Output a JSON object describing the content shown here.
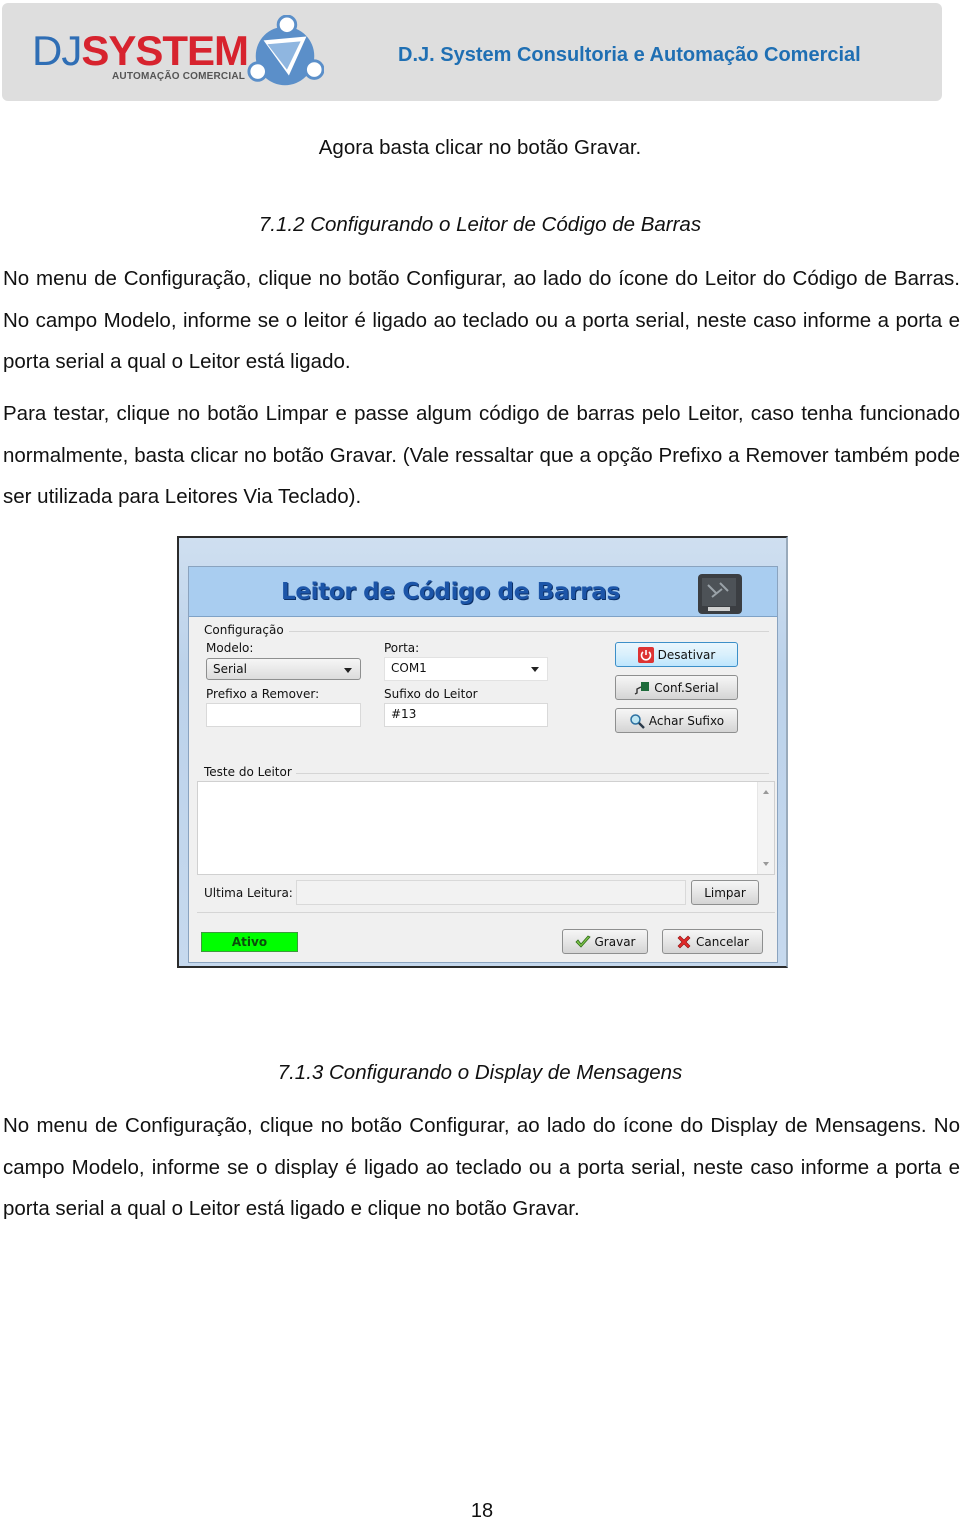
{
  "header": {
    "logo_prefix": "DJ",
    "logo_main": "SYSTEM",
    "logo_subtitle": "AUTOMAÇÃO COMERCIAL",
    "company_name": "D.J. System Consultoria e Automação Comercial",
    "colors": {
      "logo_blue": "#2f6eb5",
      "logo_red": "#d7232e",
      "title_blue": "#1f6fb3",
      "banner_bg": "#dedede"
    }
  },
  "document": {
    "intro_line": "Agora basta clicar no botão Gravar.",
    "section_712": {
      "heading": "7.1.2  Configurando o Leitor de Código de Barras",
      "paragraph_1": "No menu de Configuração, clique no botão Configurar, ao lado do ícone do Leitor do Código de Barras. No campo Modelo, informe se o leitor é ligado ao teclado ou a porta serial, neste caso informe a porta e porta serial a qual o Leitor está ligado.",
      "paragraph_2": "Para testar, clique no botão Limpar e passe algum código de barras pelo Leitor, caso tenha funcionado normalmente, basta clicar no botão Gravar. (Vale ressaltar que a opção Prefixo a Remover também pode ser utilizada para Leitores Via Teclado)."
    },
    "section_713": {
      "heading": "7.1.3  Configurando o Display de Mensagens",
      "paragraph_1": "No menu de Configuração, clique no botão Configurar, ao lado do ícone do Display de Mensagens. No campo Modelo, informe se o display é ligado ao teclado ou a porta serial, neste caso informe a porta e porta serial a qual o Leitor está ligado e clique no botão Gravar."
    },
    "page_number": "18"
  },
  "dialog": {
    "title": "Leitor de Código de Barras",
    "config_group": {
      "label": "Configuração",
      "modelo_label": "Modelo:",
      "modelo_value": "Serial",
      "porta_label": "Porta:",
      "porta_value": "COM1",
      "prefixo_label": "Prefixo a Remover:",
      "prefixo_value": "",
      "sufixo_label": "Sufixo do Leitor",
      "sufixo_value": "#13"
    },
    "buttons": {
      "desativar": "Desativar",
      "conf_serial": "Conf.Serial",
      "achar_sufixo": "Achar Sufixo",
      "limpar": "Limpar",
      "gravar": "Gravar",
      "cancelar": "Cancelar"
    },
    "test_group": {
      "label": "Teste do Leitor",
      "ultima_leitura_label": "Ultima Leitura:",
      "ultima_leitura_value": ""
    },
    "status": {
      "label": "Ativo",
      "color": "#00ff00"
    }
  }
}
